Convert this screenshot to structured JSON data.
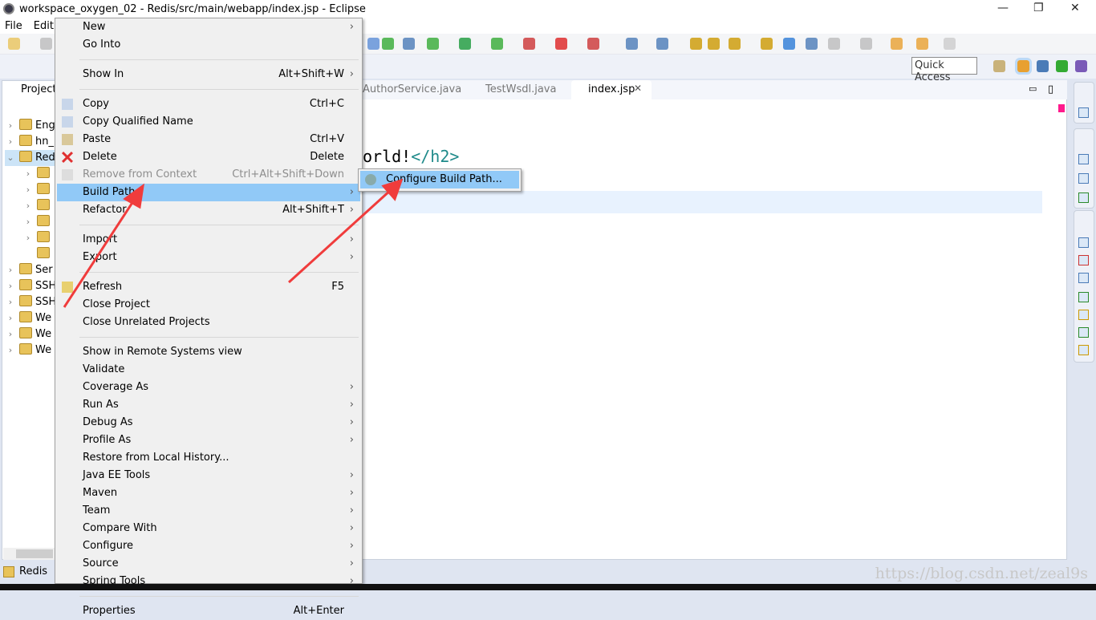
{
  "window": {
    "title": "workspace_oxygen_02 - Redis/src/main/webapp/index.jsp - Eclipse",
    "minimize": "—",
    "restore": "❐",
    "close": "✕"
  },
  "menubar": [
    "File",
    "Edit"
  ],
  "quick_access": "Quick Access",
  "explorer": {
    "tab": "Project",
    "items": [
      {
        "label": "Eng",
        "expanded": false,
        "level": 0
      },
      {
        "label": "hn_",
        "expanded": false,
        "level": 0
      },
      {
        "label": "Red",
        "expanded": true,
        "level": 0,
        "selected": true
      },
      {
        "label": "",
        "level": 1
      },
      {
        "label": "",
        "level": 1
      },
      {
        "label": "",
        "level": 1
      },
      {
        "label": "",
        "level": 1
      },
      {
        "label": "",
        "level": 1
      },
      {
        "label": "",
        "level": 1,
        "leaf": true
      },
      {
        "label": "Ser",
        "level": 0
      },
      {
        "label": "SSH",
        "level": 0
      },
      {
        "label": "SSH",
        "level": 0
      },
      {
        "label": "We",
        "level": 0
      },
      {
        "label": "We",
        "level": 0
      },
      {
        "label": "We",
        "level": 0
      }
    ]
  },
  "status": {
    "project": "Redis"
  },
  "editor": {
    "tabs": [
      "AuthorService.java",
      "TestWsdl.java",
      "index.jsp"
    ],
    "active_tab": "index.jsp",
    "code_text": "orld!",
    "code_tag": "</h2>"
  },
  "context_menu": {
    "items": [
      {
        "label": "New",
        "arrow": true
      },
      {
        "label": "Go Into"
      },
      {
        "sep": true
      },
      {
        "label": "Show In",
        "shortcut": "Alt+Shift+W",
        "arrow": true
      },
      {
        "sep": true
      },
      {
        "label": "Copy",
        "shortcut": "Ctrl+C",
        "icon": "copy-icon"
      },
      {
        "label": "Copy Qualified Name",
        "icon": "copy-qualified-icon"
      },
      {
        "label": "Paste",
        "shortcut": "Ctrl+V",
        "icon": "paste-icon"
      },
      {
        "label": "Delete",
        "shortcut": "Delete",
        "icon": "delete-icon"
      },
      {
        "label": "Remove from Context",
        "shortcut": "Ctrl+Alt+Shift+Down",
        "disabled": true,
        "icon": "remove-context-icon"
      },
      {
        "label": "Build Path",
        "arrow": true,
        "selected": true
      },
      {
        "label": "Refactor",
        "shortcut": "Alt+Shift+T",
        "arrow": true
      },
      {
        "sep": true
      },
      {
        "label": "Import",
        "arrow": true
      },
      {
        "label": "Export",
        "arrow": true
      },
      {
        "sep": true
      },
      {
        "label": "Refresh",
        "shortcut": "F5",
        "icon": "refresh-icon"
      },
      {
        "label": "Close Project"
      },
      {
        "label": "Close Unrelated Projects"
      },
      {
        "sep": true
      },
      {
        "label": "Show in Remote Systems view"
      },
      {
        "label": "Validate"
      },
      {
        "label": "Coverage As",
        "arrow": true
      },
      {
        "label": "Run As",
        "arrow": true
      },
      {
        "label": "Debug As",
        "arrow": true
      },
      {
        "label": "Profile As",
        "arrow": true
      },
      {
        "label": "Restore from Local History..."
      },
      {
        "label": "Java EE Tools",
        "arrow": true
      },
      {
        "label": "Maven",
        "arrow": true
      },
      {
        "label": "Team",
        "arrow": true
      },
      {
        "label": "Compare With",
        "arrow": true
      },
      {
        "label": "Configure",
        "arrow": true
      },
      {
        "label": "Source",
        "arrow": true
      },
      {
        "label": "Spring Tools",
        "arrow": true
      },
      {
        "sep": true
      },
      {
        "label": "Properties",
        "shortcut": "Alt+Enter"
      }
    ]
  },
  "submenu": {
    "item": "Configure Build Path..."
  },
  "watermark": "https://blog.csdn.net/zeal9s",
  "colors": {
    "selection": "#91c9f7",
    "annotation_arrow": "#f03c3c",
    "menu_bg": "#f0f0f0"
  }
}
